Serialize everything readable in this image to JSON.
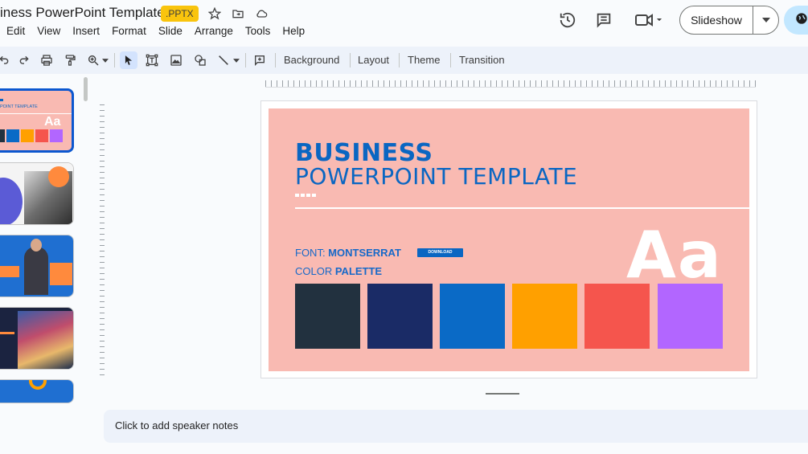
{
  "title": {
    "doc_name": "iness PowerPoint Template",
    "badge": ".PPTX"
  },
  "menu": [
    "Edit",
    "View",
    "Insert",
    "Format",
    "Slide",
    "Arrange",
    "Tools",
    "Help"
  ],
  "header": {
    "slideshow_label": "Slideshow"
  },
  "toolbar": {
    "background": "Background",
    "layout": "Layout",
    "theme": "Theme",
    "transition": "Transition"
  },
  "slide": {
    "title_line1": "BUSINESS",
    "title_line2": "POWERPOINT TEMPLATE",
    "font_prefix": "FONT: ",
    "font_name": "MONTSERRAT",
    "download": "DOWNLOAD",
    "palette_prefix": "COLOR ",
    "palette_word": "PALETTE",
    "aa": "Aa",
    "background_color": "#f9bab2",
    "palette_colors": [
      "#22313f",
      "#1a2b66",
      "#0a6ac6",
      "#ffa000",
      "#f5554d",
      "#b266ff"
    ]
  },
  "filmstrip": {
    "thumb1_caption": "POINT TEMPLATE",
    "thumb1_aa": "Aa"
  },
  "notes": {
    "placeholder": "Click to add speaker notes"
  },
  "colors": {
    "accent": "#0b57d0",
    "badge": "#f9c40d",
    "share": "#c2e7ff"
  }
}
